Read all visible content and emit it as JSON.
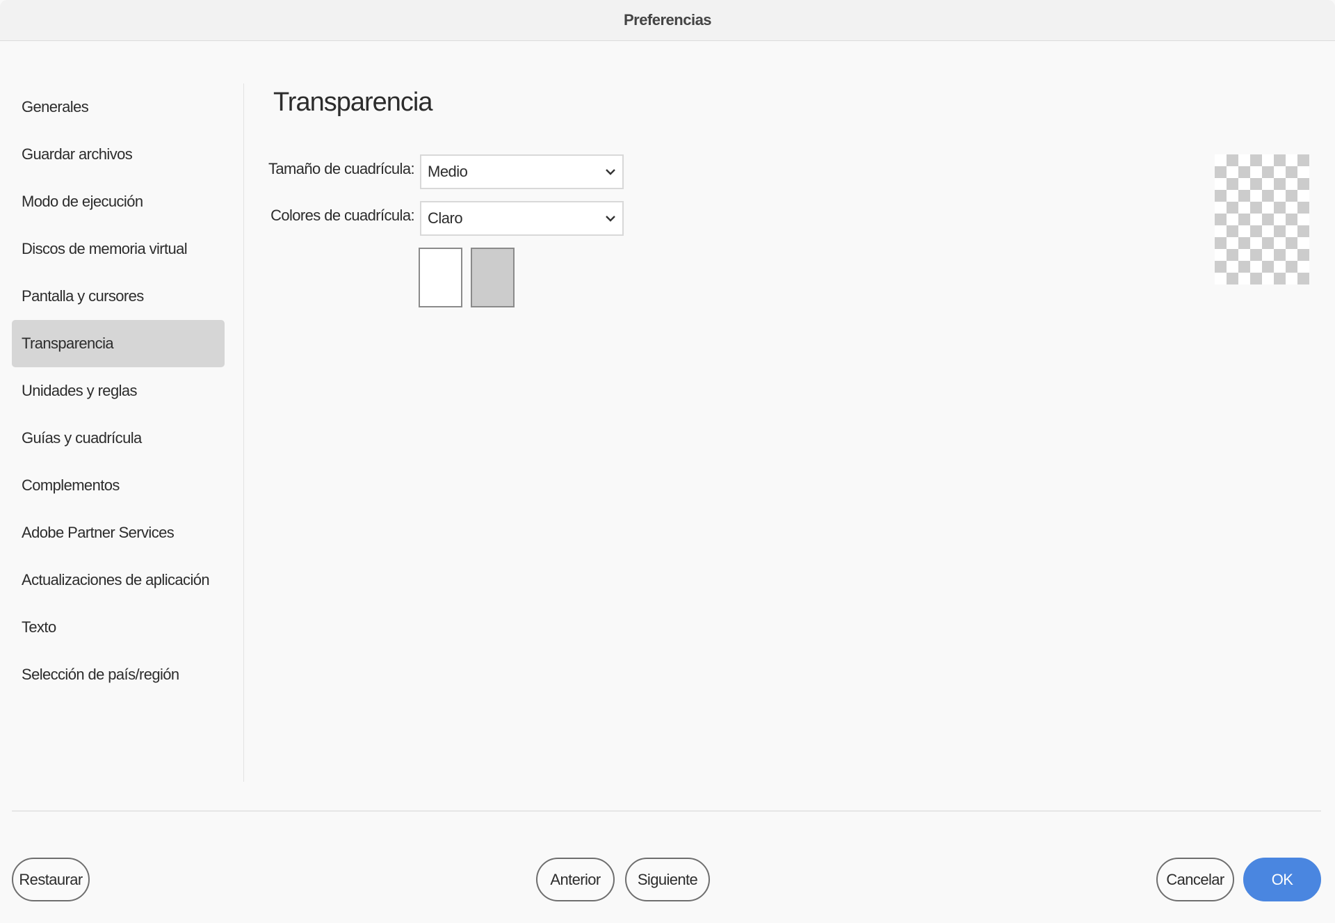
{
  "window": {
    "title": "Preferencias"
  },
  "sidebar": {
    "items": [
      {
        "label": "Generales"
      },
      {
        "label": "Guardar archivos"
      },
      {
        "label": "Modo de ejecución"
      },
      {
        "label": "Discos de memoria virtual"
      },
      {
        "label": "Pantalla y cursores"
      },
      {
        "label": "Transparencia",
        "selected": true
      },
      {
        "label": "Unidades y reglas"
      },
      {
        "label": "Guías y cuadrícula"
      },
      {
        "label": "Complementos"
      },
      {
        "label": "Adobe Partner Services"
      },
      {
        "label": "Actualizaciones de aplicación"
      },
      {
        "label": "Texto"
      },
      {
        "label": "Selección de país/región"
      }
    ]
  },
  "main": {
    "heading": "Transparencia",
    "grid_size": {
      "label": "Tamaño de cuadrícula:",
      "value": "Medio"
    },
    "grid_colors": {
      "label": "Colores de cuadrícula:",
      "value": "Claro",
      "swatch_1": "#ffffff",
      "swatch_2": "#cccccc"
    },
    "preview_icon": "transparency-checkerboard"
  },
  "footer": {
    "restore": "Restaurar",
    "previous": "Anterior",
    "next": "Siguiente",
    "cancel": "Cancelar",
    "ok": "OK",
    "accent": "#4a86e0"
  }
}
